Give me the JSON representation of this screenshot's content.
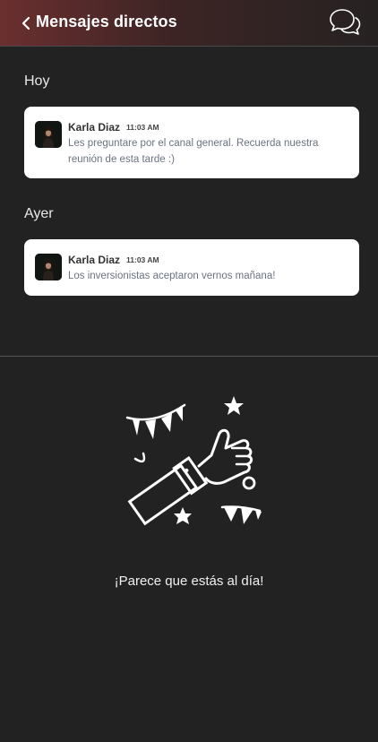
{
  "header": {
    "title": "Mensajes directos"
  },
  "sections": [
    {
      "label": "Hoy",
      "messages": [
        {
          "sender": "Karla Diaz",
          "time": "11:03 AM",
          "text": "Les preguntare por el canal general. Recuerda nuestra reunión de esta tarde :)"
        }
      ]
    },
    {
      "label": "Ayer",
      "messages": [
        {
          "sender": "Karla Diaz",
          "time": "11:03 AM",
          "text": "Los inversionistas aceptaron vernos mañana!"
        }
      ]
    }
  ],
  "empty_state": {
    "text": "¡Parece que estás al día!"
  },
  "colors": {
    "background": "#222222",
    "header_gradient_start": "#6b2f2f",
    "card": "#ffffff",
    "message_text": "#6b7280"
  },
  "icons": [
    "chevron-left-icon",
    "chat-bubbles-icon",
    "celebration-thumbs-up-illustration"
  ]
}
